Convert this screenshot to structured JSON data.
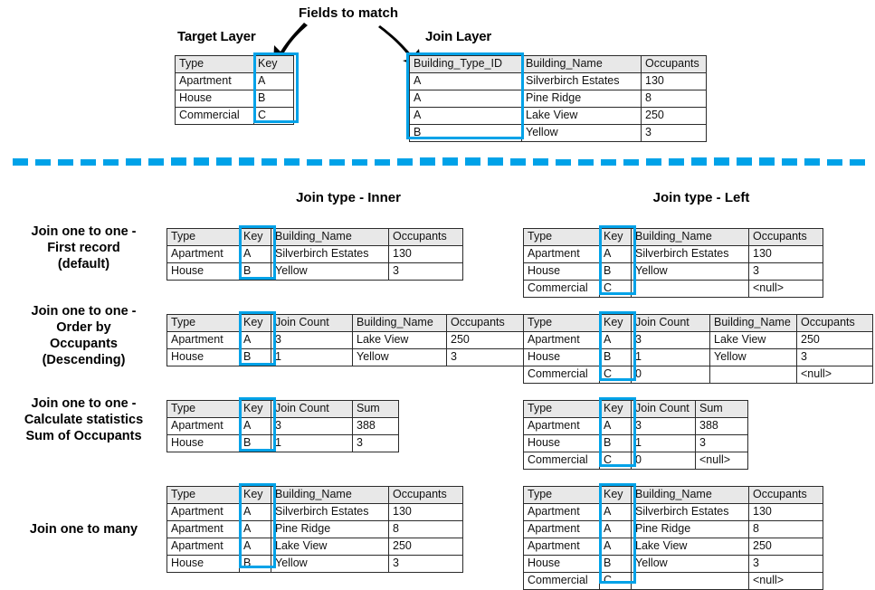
{
  "top": {
    "fields_to_match_label": "Fields to match",
    "target_layer_label": "Target Layer",
    "join_layer_label": "Join Layer",
    "target_table": {
      "headers": [
        "Type",
        "Key"
      ],
      "rows": [
        [
          "Apartment",
          "A"
        ],
        [
          "House",
          "B"
        ],
        [
          "Commercial",
          "C"
        ]
      ]
    },
    "join_table": {
      "headers": [
        "Building_Type_ID",
        "Building_Name",
        "Occupants"
      ],
      "rows": [
        [
          "A",
          "Silverbirch Estates",
          "130"
        ],
        [
          "A",
          "Pine Ridge",
          "8"
        ],
        [
          "A",
          "Lake View",
          "250"
        ],
        [
          "B",
          "Yellow",
          "3"
        ]
      ]
    }
  },
  "columns": {
    "inner_label": "Join type - Inner",
    "left_label": "Join type - Left"
  },
  "rows": [
    {
      "label": "Join one to one -\nFirst record\n(default)",
      "label_lines": [
        "Join one to one -",
        "First record",
        "(default)"
      ],
      "inner": {
        "headers": [
          "Type",
          "Key",
          "Building_Name",
          "Occupants"
        ],
        "rows": [
          [
            "Apartment",
            "A",
            "Silverbirch Estates",
            "130"
          ],
          [
            "House",
            "B",
            "Yellow",
            "3"
          ]
        ]
      },
      "left": {
        "headers": [
          "Type",
          "Key",
          "Building_Name",
          "Occupants"
        ],
        "rows": [
          [
            "Apartment",
            "A",
            "Silverbirch Estates",
            "130"
          ],
          [
            "House",
            "B",
            "Yellow",
            "3"
          ],
          [
            "Commercial",
            "C",
            "",
            "<null>"
          ]
        ]
      }
    },
    {
      "label_lines": [
        "Join one to one -",
        "Order by",
        "Occupants",
        "(Descending)"
      ],
      "inner": {
        "headers": [
          "Type",
          "Key",
          "Join Count",
          "Building_Name",
          "Occupants"
        ],
        "rows": [
          [
            "Apartment",
            "A",
            "3",
            "Lake View",
            "250"
          ],
          [
            "House",
            "B",
            "1",
            "Yellow",
            "3"
          ]
        ]
      },
      "left": {
        "headers": [
          "Type",
          "Key",
          "Join Count",
          "Building_Name",
          "Occupants"
        ],
        "rows": [
          [
            "Apartment",
            "A",
            "3",
            "Lake View",
            "250"
          ],
          [
            "House",
            "B",
            "1",
            "Yellow",
            "3"
          ],
          [
            "Commercial",
            "C",
            "0",
            "",
            "<null>"
          ]
        ]
      }
    },
    {
      "label_lines": [
        "Join one to one -",
        "Calculate statistics",
        "Sum of Occupants"
      ],
      "inner": {
        "headers": [
          "Type",
          "Key",
          "Join Count",
          "Sum"
        ],
        "rows": [
          [
            "Apartment",
            "A",
            "3",
            "388"
          ],
          [
            "House",
            "B",
            "1",
            "3"
          ]
        ]
      },
      "left": {
        "headers": [
          "Type",
          "Key",
          "Join Count",
          "Sum"
        ],
        "rows": [
          [
            "Apartment",
            "A",
            "3",
            "388"
          ],
          [
            "House",
            "B",
            "1",
            "3"
          ],
          [
            "Commercial",
            "C",
            "0",
            "<null>"
          ]
        ]
      }
    },
    {
      "label_lines": [
        "Join one to many"
      ],
      "inner": {
        "headers": [
          "Type",
          "Key",
          "Building_Name",
          "Occupants"
        ],
        "rows": [
          [
            "Apartment",
            "A",
            "Silverbirch Estates",
            "130"
          ],
          [
            "Apartment",
            "A",
            "Pine Ridge",
            "8"
          ],
          [
            "Apartment",
            "A",
            "Lake View",
            "250"
          ],
          [
            "House",
            "B",
            "Yellow",
            "3"
          ]
        ]
      },
      "left": {
        "headers": [
          "Type",
          "Key",
          "Building_Name",
          "Occupants"
        ],
        "rows": [
          [
            "Apartment",
            "A",
            "Silverbirch Estates",
            "130"
          ],
          [
            "Apartment",
            "A",
            "Pine Ridge",
            "8"
          ],
          [
            "Apartment",
            "A",
            "Lake View",
            "250"
          ],
          [
            "House",
            "B",
            "Yellow",
            "3"
          ],
          [
            "Commercial",
            "C",
            "",
            "<null>"
          ]
        ]
      }
    }
  ],
  "colors": {
    "highlight": "#00a2e8",
    "header_fill": "#e8e8e8",
    "border": "#2b2b2b",
    "text": "#000000"
  }
}
